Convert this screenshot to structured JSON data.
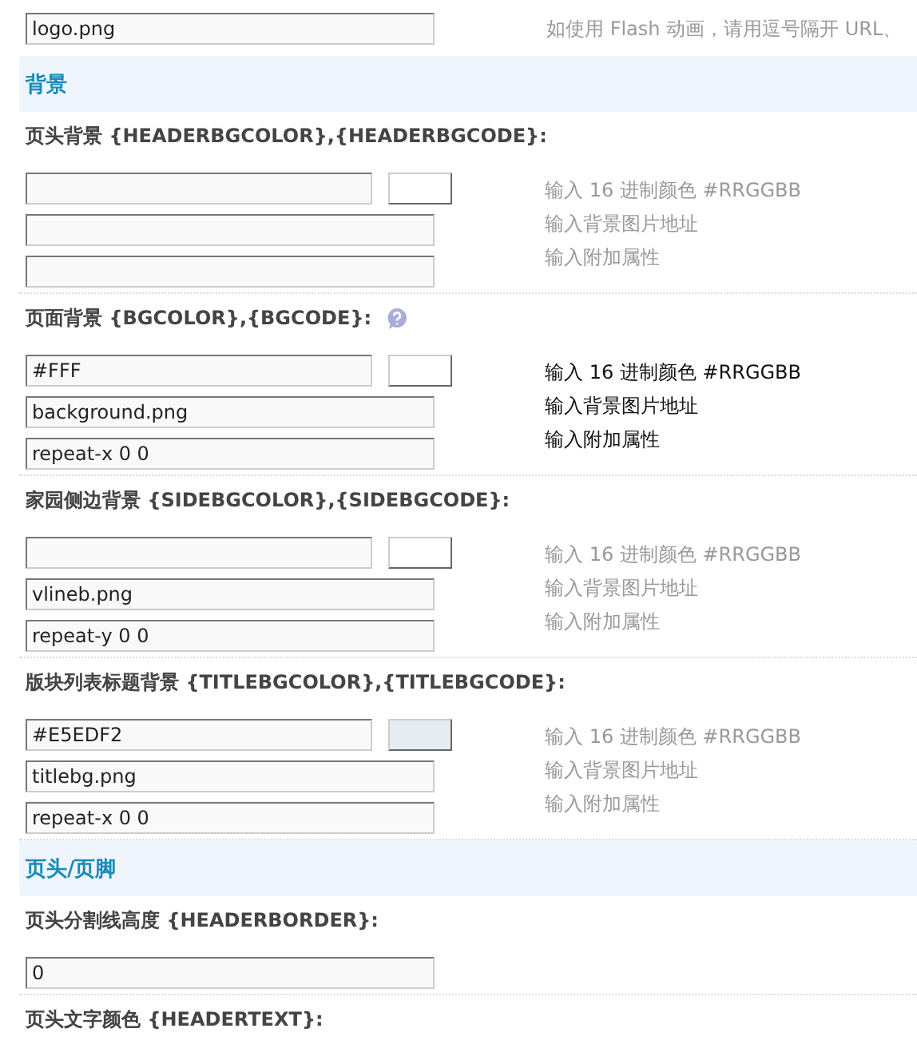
{
  "top_field": {
    "value": "logo.png",
    "hint": "如使用 Flash 动画，请用逗号隔开 URL、"
  },
  "sections": [
    {
      "kind": "header",
      "title": "背景"
    },
    {
      "kind": "background",
      "label": "页头背景",
      "code": "{HEADERBGCOLOR},{HEADERBGCODE}:",
      "help": false,
      "color": "#ffffff",
      "hints": [
        "输入 16 进制颜色 #RRGGBB",
        "输入背景图片地址",
        "输入附加属性"
      ],
      "highlighted": false
    },
    {
      "kind": "background",
      "label": "页面背景",
      "code": "{BGCOLOR},{BGCODE}:",
      "help": true,
      "value": "#FFF",
      "color": "#ffffff",
      "image": "background.png",
      "extra": "repeat-x 0 0",
      "hints": [
        "输入 16 进制颜色 #RRGGBB",
        "输入背景图片地址",
        "输入附加属性"
      ],
      "highlighted": true
    },
    {
      "kind": "background",
      "label": "家园侧边背景",
      "code": "{SIDEBGCOLOR},{SIDEBGCODE}:",
      "help": false,
      "color": "#ffffff",
      "image": "vlineb.png",
      "extra": "repeat-y 0 0",
      "hints": [
        "输入 16 进制颜色 #RRGGBB",
        "输入背景图片地址",
        "输入附加属性"
      ],
      "highlighted": false
    },
    {
      "kind": "background",
      "label": "版块列表标题背景",
      "code": "{TITLEBGCOLOR},{TITLEBGCODE}:",
      "help": false,
      "value": "#E5EDF2",
      "color": "#e5edf2",
      "image": "titlebg.png",
      "extra": "repeat-x 0 0",
      "hints": [
        "输入 16 进制颜色 #RRGGBB",
        "输入背景图片地址",
        "输入附加属性"
      ],
      "highlighted": false
    },
    {
      "kind": "header",
      "title": "页头/页脚"
    },
    {
      "kind": "text",
      "label": "页头分割线高度",
      "code": "{HEADERBORDER}:",
      "value": "0"
    },
    {
      "kind": "label",
      "label": "页头文字颜色",
      "code": "{HEADERTEXT}:"
    }
  ]
}
